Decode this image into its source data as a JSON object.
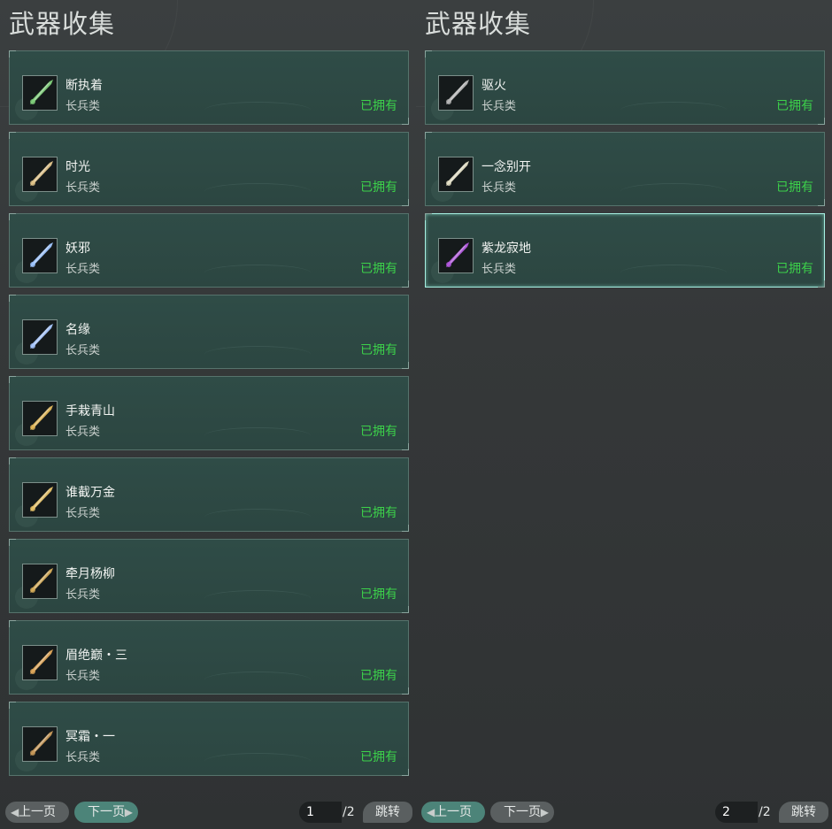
{
  "panels": [
    {
      "title": "武器收集",
      "items": [
        {
          "name": "断执着",
          "category": "长兵类",
          "status": "已拥有",
          "icon": "jade-spear-icon",
          "color": "#7fd07a"
        },
        {
          "name": "时光",
          "category": "长兵类",
          "status": "已拥有",
          "icon": "golden-spear-icon",
          "color": "#e0c48a"
        },
        {
          "name": "妖邪",
          "category": "长兵类",
          "status": "已拥有",
          "icon": "ice-blade-icon",
          "color": "#9fc6ff"
        },
        {
          "name": "名缘",
          "category": "长兵类",
          "status": "已拥有",
          "icon": "frost-blade-icon",
          "color": "#a9c8ff"
        },
        {
          "name": "手栽青山",
          "category": "长兵类",
          "status": "已拥有",
          "icon": "phoenix-spear-icon",
          "color": "#e2b85a"
        },
        {
          "name": "谁截万金",
          "category": "长兵类",
          "status": "已拥有",
          "icon": "phoenix-spear-icon",
          "color": "#e8c46a"
        },
        {
          "name": "牵月杨柳",
          "category": "长兵类",
          "status": "已拥有",
          "icon": "trident-icon",
          "color": "#d6ad5a"
        },
        {
          "name": "眉绝巅・三",
          "category": "长兵类",
          "status": "已拥有",
          "icon": "flame-spear-icon",
          "color": "#e0a85a"
        },
        {
          "name": "冥霜・一",
          "category": "长兵类",
          "status": "已拥有",
          "icon": "bronze-spear-icon",
          "color": "#c89a5a"
        }
      ],
      "pager": {
        "prev": "上一页",
        "next": "下一页",
        "page": "1",
        "total": "/2",
        "jump": "跳转",
        "active": "next"
      }
    },
    {
      "title": "武器收集",
      "items": [
        {
          "name": "驱火",
          "category": "长兵类",
          "status": "已拥有",
          "icon": "dark-blade-icon",
          "color": "#b8b8b8"
        },
        {
          "name": "一念别开",
          "category": "长兵类",
          "status": "已拥有",
          "icon": "silver-spear-icon",
          "color": "#e6e2c8"
        },
        {
          "name": "紫龙寂地",
          "category": "长兵类",
          "status": "已拥有",
          "icon": "purple-dragon-spear-icon",
          "color": "#b45ae0"
        }
      ],
      "pager": {
        "prev": "上一页",
        "next": "下一页",
        "page": "2",
        "total": "/2",
        "jump": "跳转",
        "active": "prev"
      }
    }
  ],
  "colors": {
    "owned": "#3cd14a",
    "accent": "#4c8479",
    "selected_border": "#a6f0e2"
  }
}
